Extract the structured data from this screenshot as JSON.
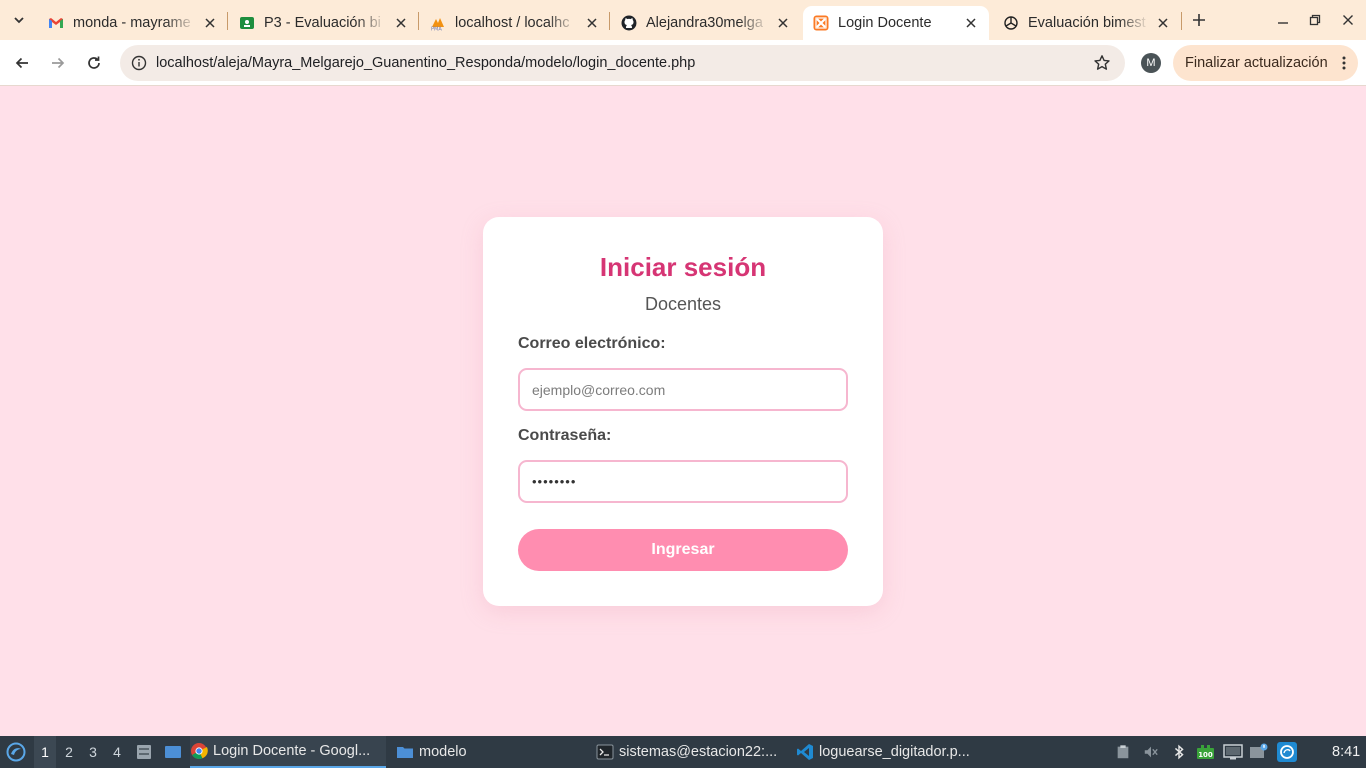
{
  "browser": {
    "tabs": [
      {
        "title": "monda - mayrame",
        "icon": "gmail-icon"
      },
      {
        "title": "P3 - Evaluación bi",
        "icon": "classroom-icon"
      },
      {
        "title": "localhost / localhc",
        "icon": "phpmyadmin-icon"
      },
      {
        "title": "Alejandra30melga",
        "icon": "github-icon"
      },
      {
        "title": "Login Docente",
        "icon": "xampp-icon"
      },
      {
        "title": "Evaluación bimest",
        "icon": "chatgpt-icon"
      }
    ],
    "active_tab": "Login Docente",
    "url": "localhost/aleja/Mayra_Melgarejo_Guanentino_Responda/modelo/login_docente.php",
    "profile_initial": "M",
    "update_button": "Finalizar actualización"
  },
  "page": {
    "title": "Iniciar sesión",
    "subtitle": "Docentes",
    "email_label": "Correo electrónico:",
    "email_placeholder": "ejemplo@correo.com",
    "password_label": "Contraseña:",
    "password_value": "••••••••",
    "submit_label": "Ingresar",
    "colors": {
      "background": "#ffe0e9",
      "title": "#d63574",
      "button": "#ff8db0",
      "input_border": "#f6b6cf"
    }
  },
  "taskbar": {
    "workspaces": [
      "1",
      "2",
      "3",
      "4"
    ],
    "active_workspace": "1",
    "tasks": [
      {
        "label": "Login Docente - Googl...",
        "icon": "chrome-icon"
      },
      {
        "label": "modelo",
        "icon": "folder-icon"
      },
      {
        "label": "sistemas@estacion22:...",
        "icon": "terminal-icon"
      },
      {
        "label": "loguearse_digitador.p...",
        "icon": "vscode-icon"
      }
    ],
    "battery": "100",
    "clock": "8:41"
  }
}
